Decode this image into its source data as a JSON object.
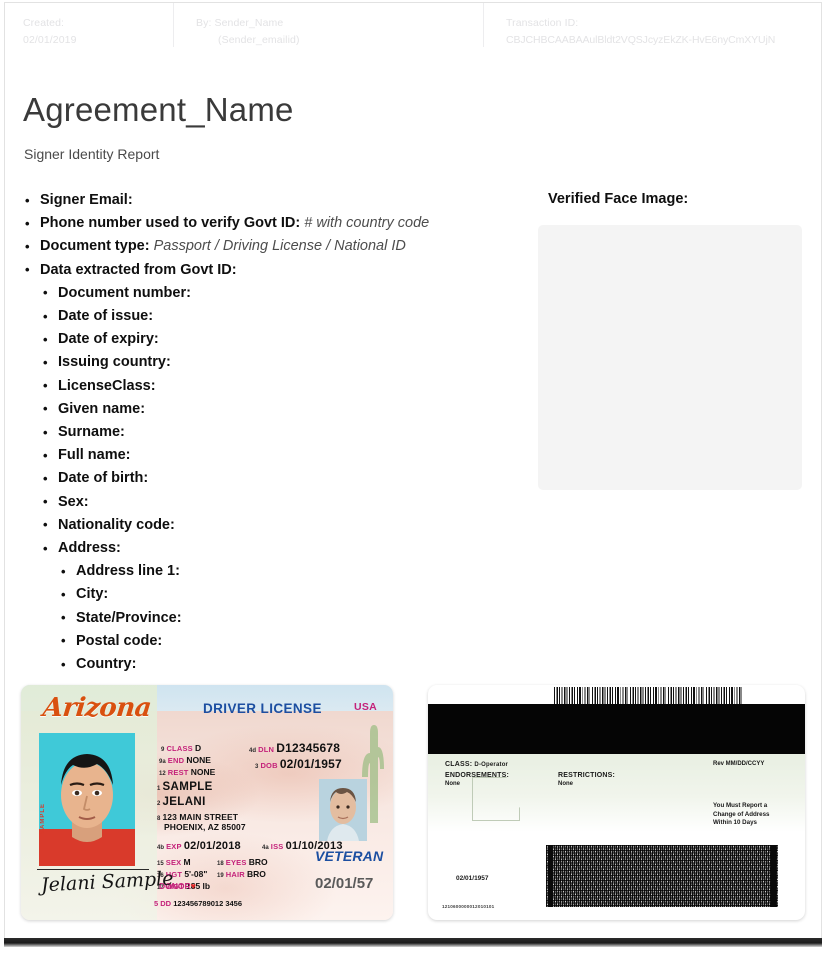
{
  "header": {
    "created_label": "Created:",
    "created_value": "02/01/2019",
    "by_label": "By: Sender_Name",
    "by_email": "(Sender_emailid)",
    "transaction_label": "Transaction ID:",
    "transaction_value": "CBJCHBCAABAAulBldt2VQSJcyzEkZK-HvE6nyCmXYUjN"
  },
  "document": {
    "title": "Agreement_Name",
    "subtitle": "Signer Identity Report"
  },
  "fields": {
    "signer_email": "Signer Email:",
    "phone_label": "Phone number used to verify Govt ID:",
    "phone_value": "# with country code",
    "doc_type_label": "Document type:",
    "doc_type_value": "Passport / Driving License / National ID",
    "extracted_label": "Data extracted from Govt ID:",
    "extracted": [
      "Document number:",
      "Date of issue:",
      "Date of expiry:",
      "Issuing country:",
      "LicenseClass:",
      "Given name:",
      "Surname:",
      "Full name:",
      "Date of birth:",
      "Sex:",
      "Nationality code:",
      "Address:"
    ],
    "address_label": "Address:",
    "address_sub": [
      "Address line 1:",
      "City:",
      "State/Province:",
      "Postal code:",
      "Country:"
    ]
  },
  "face_panel": {
    "label": "Verified Face Image:"
  },
  "license_front": {
    "state": "Arizona",
    "doc_title": "DRIVER LICENSE",
    "country": "USA",
    "photo_watermark": "SAMPLE",
    "signature": "Jelani Sample",
    "rows": [
      {
        "num": "9",
        "key": "CLASS",
        "value": "D"
      },
      {
        "num": "9a",
        "key": "END",
        "value": "NONE"
      },
      {
        "num": "12",
        "key": "REST",
        "value": "NONE"
      }
    ],
    "dln_num": "4d",
    "dln_key": "DLN",
    "dln_value": "D12345678",
    "dob_num": "3",
    "dob_key": "DOB",
    "dob_value": "02/01/1957",
    "surname_num": "1",
    "surname": "SAMPLE",
    "given_num": "2",
    "given": "JELANI",
    "addr_num": "8",
    "addr_line1": "123 MAIN STREET",
    "addr_line2": "PHOENIX, AZ 85007",
    "exp_num": "4b",
    "exp_key": "EXP",
    "exp_value": "02/01/2018",
    "iss_num": "4a",
    "iss_key": "ISS",
    "iss_value": "01/10/2013",
    "sex_num": "15",
    "sex_key": "SEX",
    "sex_value": "M",
    "eyes_num": "18",
    "eyes_key": "EYES",
    "eyes_value": "BRO",
    "hgt_num": "16",
    "hgt_key": "HGT",
    "hgt_value": "5'-08\"",
    "hair_num": "19",
    "hair_key": "HAIR",
    "hair_value": "BRO",
    "wgt_num": "17",
    "wgt_key": "WGT",
    "wgt_value": "185 lb",
    "veteran": "VETERAN",
    "dob_big": "02/01/57",
    "donor_label": "DONOR",
    "dd_num": "5",
    "dd_key": "DD",
    "dd_value": "123456789012 3456"
  },
  "license_back": {
    "class_label": "CLASS:",
    "class_value": "D-Operator",
    "endorsements_label": "ENDORSEMENTS:",
    "endorsements_value": "None",
    "restrictions_label": "RESTRICTIONS:",
    "restrictions_value": "None",
    "rev_label": "Rev MM/DD/CCYY",
    "notice_line1": "You Must Report a",
    "notice_line2": "Change of Address",
    "notice_line3": "Within 10 Days",
    "dob": "02/01/1957",
    "serial": "1210600000012010101"
  },
  "colors": {
    "az_orange": "#d9500f",
    "az_blue": "#1c4fa1",
    "az_magenta": "#c4227a",
    "meta_text": "#e3e3e5"
  }
}
